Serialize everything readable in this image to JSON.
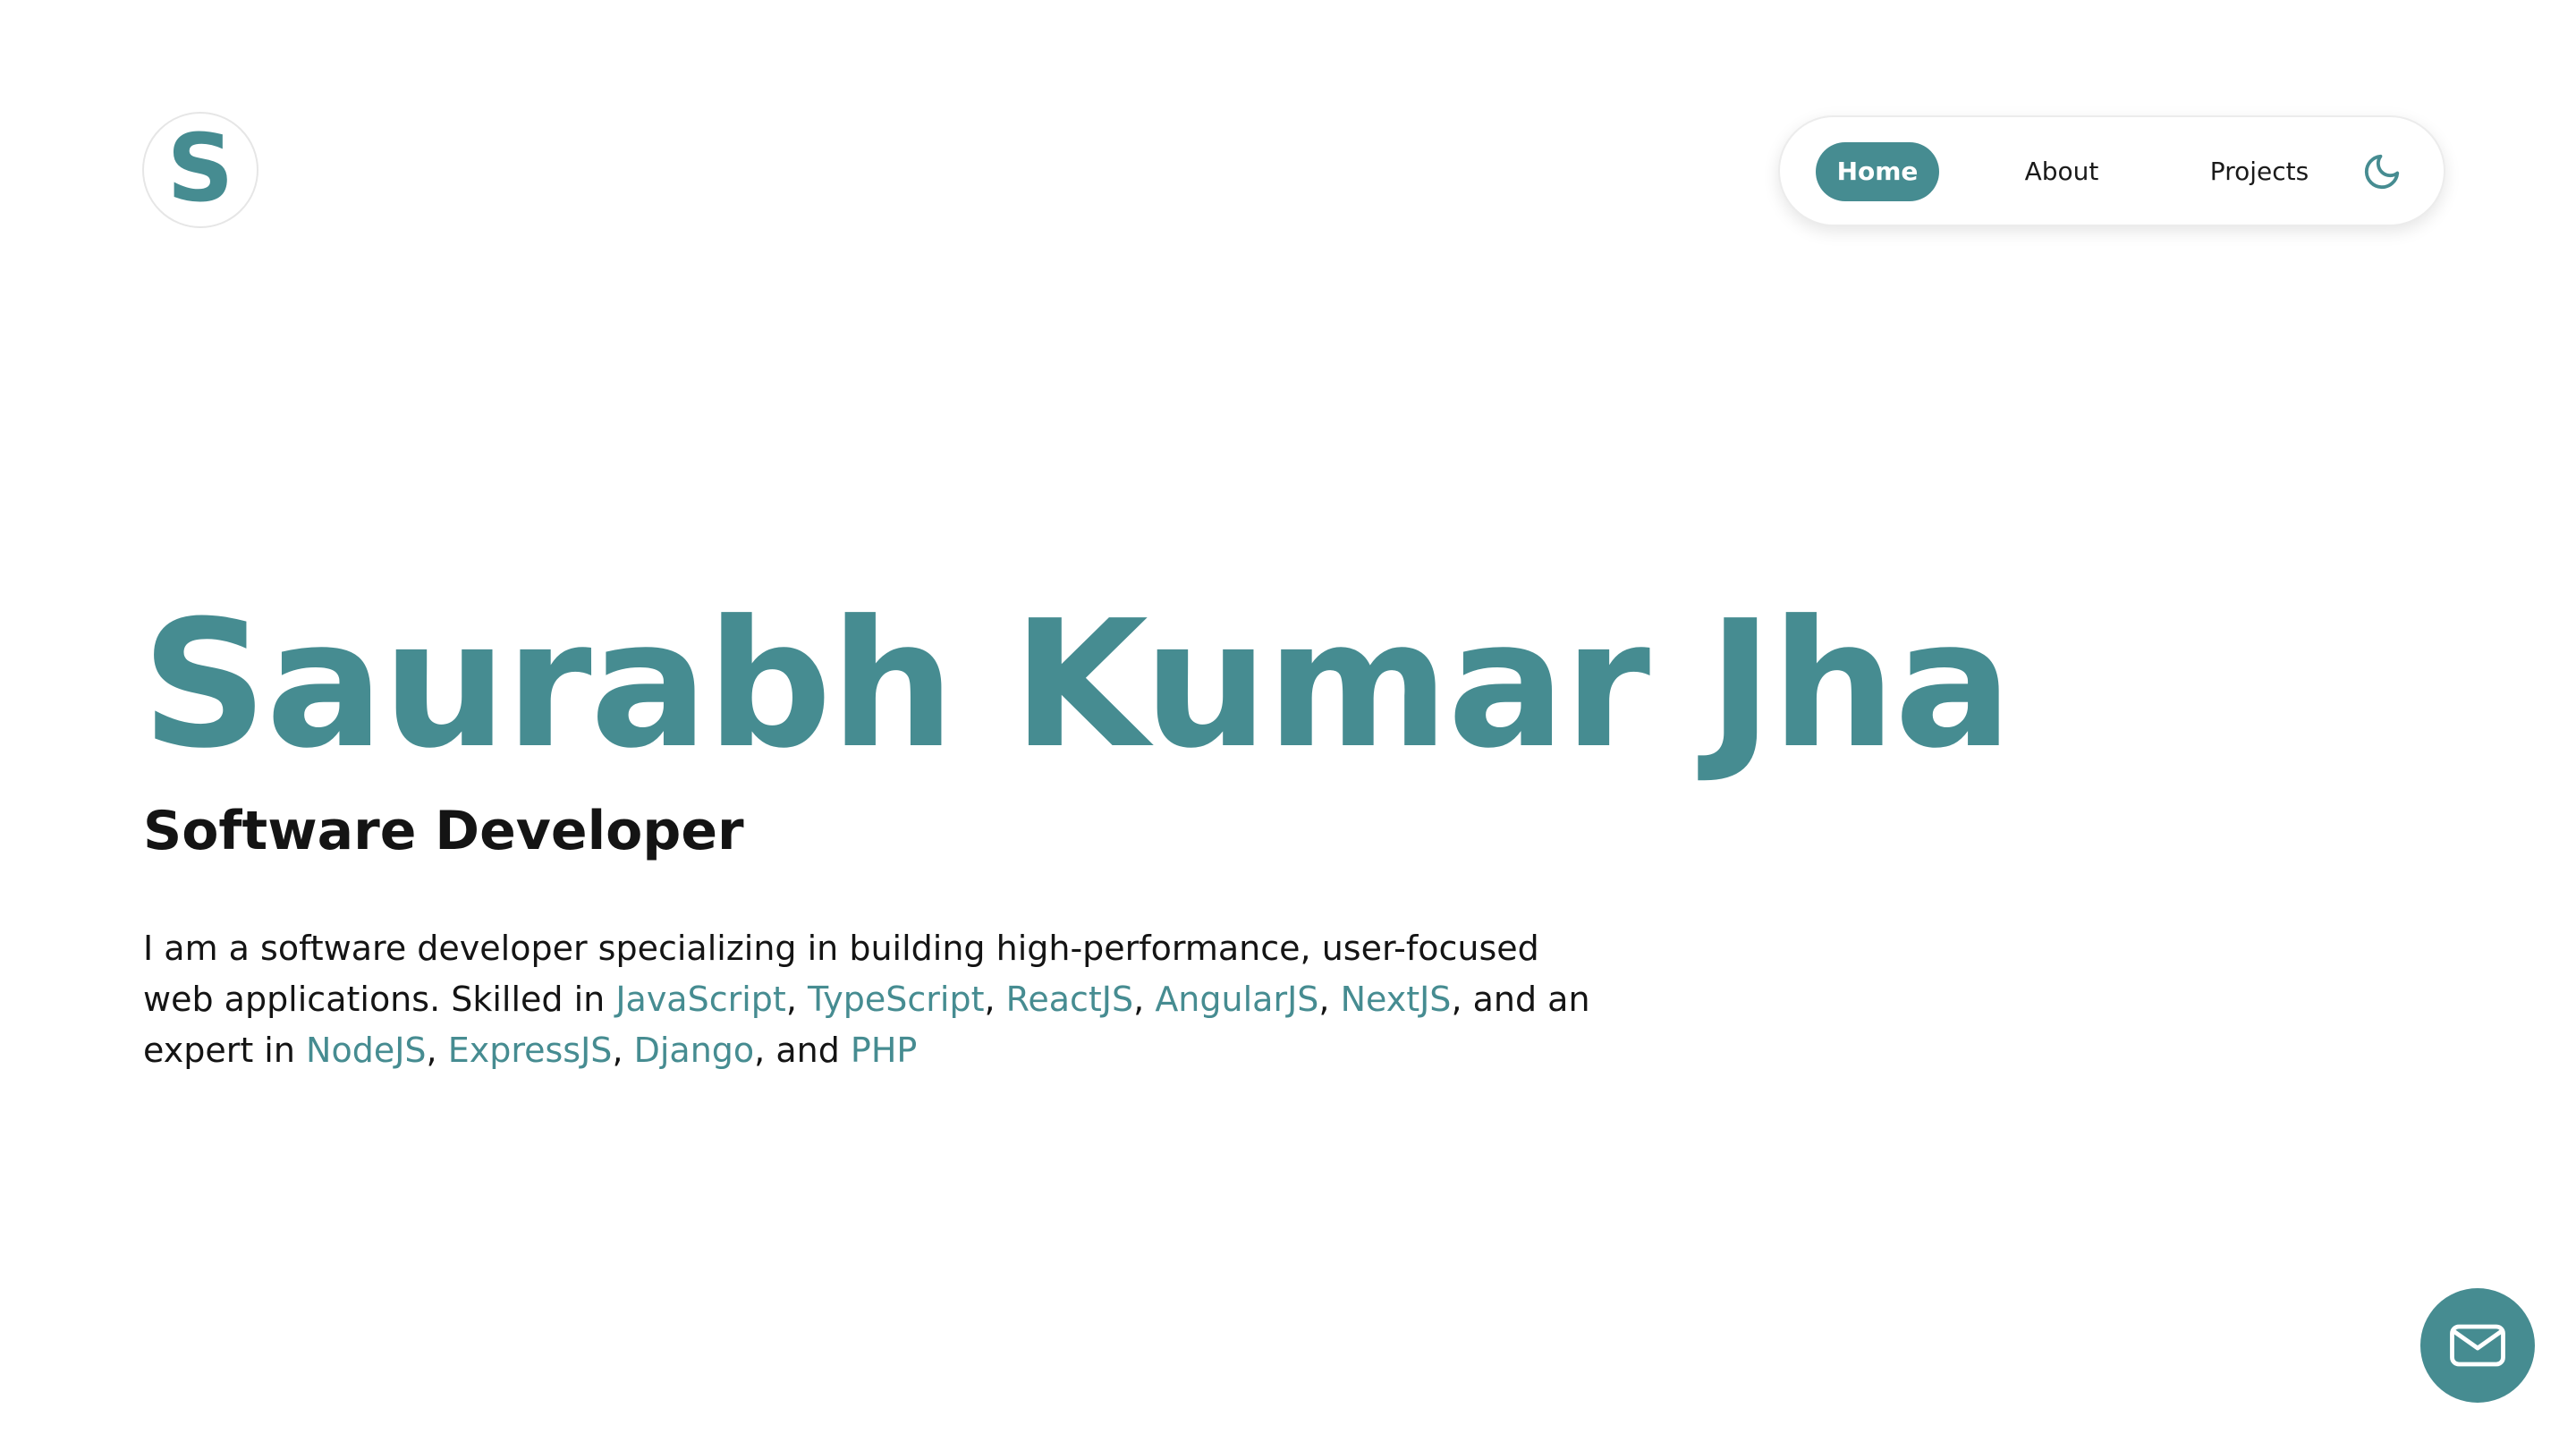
{
  "logo": {
    "letter": "S"
  },
  "nav": {
    "items": [
      {
        "label": "Home",
        "active": true
      },
      {
        "label": "About",
        "active": false
      },
      {
        "label": "Projects",
        "active": false
      }
    ],
    "theme_toggle_icon": "moon-icon"
  },
  "hero": {
    "name": "Saurabh Kumar Jha",
    "role": "Software Developer",
    "bio": {
      "intro": "I am a software developer specializing in building high-performance, user-focused web applications. Skilled in ",
      "skilled_in": [
        "JavaScript",
        "TypeScript",
        "ReactJS",
        "AngularJS",
        "NextJS"
      ],
      "expert_connector": ", and an expert in ",
      "expert_in": [
        "NodeJS",
        "ExpressJS",
        "Django"
      ],
      "final_connector": ", and ",
      "final": "PHP"
    }
  },
  "contact_button": {
    "icon": "mail-icon"
  },
  "colors": {
    "accent": "#468c91",
    "text": "#141414",
    "background": "#ffffff"
  }
}
